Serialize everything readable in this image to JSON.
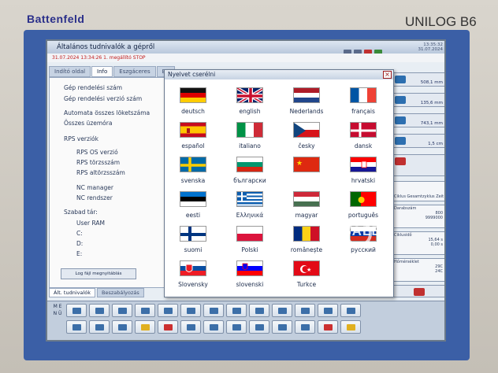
{
  "hardware": {
    "brand": "Battenfeld",
    "model": "UNILOG B6"
  },
  "window": {
    "title": "Általános tudnivalók a gépről",
    "datetime": "31.07.2024 13:34:26",
    "alarm": "1. megállító STOP",
    "clock_time": "13:35:32",
    "clock_date": "31.07.2024"
  },
  "tabs": [
    "Indító oldal",
    "Info",
    "Eszgáceres",
    "Be"
  ],
  "info": {
    "gep_rendelesi_szam": "Gép rendelési szám",
    "gep_rendelesi_verzio_szam": "Gép rendelési verzió szám",
    "automata_loketszam": "Automata összes löketszáma",
    "osszes_uzemora": "Összes üzemóra",
    "rps_verziok": "RPS verziók",
    "rps_os_verzio": "RPS OS verzió",
    "rps_torzsszam": "RPS törzsszám",
    "rps_altorzsszam": "RPS altörzsszám",
    "nc_manager": "NC manager",
    "nc_rendszer": "NC rendszer",
    "szabad_tar": "Szabad tár:",
    "user_ram": "User RAM",
    "c": "C:",
    "d": "D:",
    "e": "E:",
    "log_button": "Log fájl megnyitáblás"
  },
  "bottom_tabs": [
    "Ált. tudnivalók",
    "Beszabályozás"
  ],
  "dialog": {
    "title": "Nyelvet cserélni",
    "close": "×",
    "languages": [
      {
        "name": "deutsch",
        "flag": "de"
      },
      {
        "name": "english",
        "flag": "gb"
      },
      {
        "name": "Nederlands",
        "flag": "nl"
      },
      {
        "name": "français",
        "flag": "fr"
      },
      {
        "name": "español",
        "flag": "es"
      },
      {
        "name": "italiano",
        "flag": "it"
      },
      {
        "name": "česky",
        "flag": "cz"
      },
      {
        "name": "dansk",
        "flag": "dk"
      },
      {
        "name": "svenska",
        "flag": "se"
      },
      {
        "name": "български",
        "flag": "bg"
      },
      {
        "name": "",
        "flag": "cn"
      },
      {
        "name": "hrvatski",
        "flag": "hr"
      },
      {
        "name": "eesti",
        "flag": "ee"
      },
      {
        "name": "Ελληνικά",
        "flag": "gr"
      },
      {
        "name": "magyar",
        "flag": "hu"
      },
      {
        "name": "português",
        "flag": "pt"
      },
      {
        "name": "suomi",
        "flag": "fi"
      },
      {
        "name": "Polski",
        "flag": "pl"
      },
      {
        "name": "românește",
        "flag": "ro"
      },
      {
        "name": "русский",
        "flag": "ru"
      },
      {
        "name": "Slovensky",
        "flag": "sk"
      },
      {
        "name": "slovenski",
        "flag": "si"
      },
      {
        "name": "Turkce",
        "flag": "tr"
      }
    ]
  },
  "right_panel": {
    "r1": "508,1 mm",
    "r2": "135,6 mm",
    "r3": "743,1 mm",
    "r4": "1,5 cm",
    "r5": "",
    "r6_label": "Ciklus Gesamtzyklus Zeit",
    "r7_label": "Darabszám",
    "r7_a": "800",
    "r7_b": "9999000",
    "r8_label": "Ciklusidő",
    "r8_a": "15,64 s",
    "r8_b": "0,00 s",
    "r9_label": "Hőmérséklet",
    "r9_a": "29C",
    "r9_b": "24C"
  },
  "menu_label": "M E N Ü",
  "watermark": "ESALE"
}
